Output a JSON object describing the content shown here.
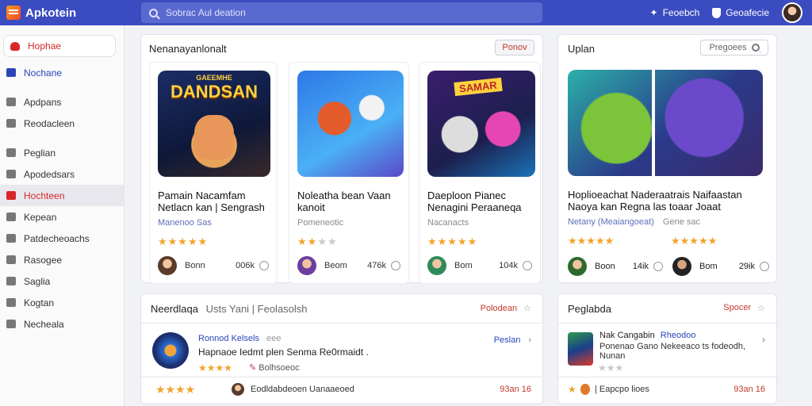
{
  "app": {
    "name": "Apkotein"
  },
  "search": {
    "placeholder": "Sobrac Aul deation"
  },
  "header": {
    "link1": "Feoebch",
    "link2": "Geoafecie"
  },
  "sidebar": {
    "items": [
      {
        "label": "Hophae"
      },
      {
        "label": "Nochane"
      },
      {
        "label": "Apdpans"
      },
      {
        "label": "Reodacleen"
      },
      {
        "label": "Peglian"
      },
      {
        "label": "Apodedsars"
      },
      {
        "label": "Hochteen"
      },
      {
        "label": "Kepean"
      },
      {
        "label": "Patdecheoachs"
      },
      {
        "label": "Rasogee"
      },
      {
        "label": "Saglia"
      },
      {
        "label": "Kogtan"
      },
      {
        "label": "Necheala"
      }
    ]
  },
  "featured": {
    "title": "Nenanayanlonalt",
    "button": "Ponov",
    "cards": [
      {
        "thumb_text": "DANDSAN",
        "thumb_top": "GAEEMHE",
        "title": "Pamain Nacamfam Netlacn kan | Sengrash",
        "sub": "Manenoo Sas",
        "stars": "★★★★★",
        "dim": "",
        "user": "Bonn",
        "count": "006k"
      },
      {
        "thumb_text": "",
        "thumb_top": "",
        "title": "Noleatha bean Vaan kanoit",
        "sub": "Pomeneotic",
        "stars": "★★",
        "dim": "★★",
        "user": "Beom",
        "count": "476k"
      },
      {
        "thumb_text": "",
        "thumb_top": "SAMAR",
        "title": "Daeploon Pianec Nenagini Peraaneqa",
        "sub": "Nacanacts",
        "stars": "★★★★★",
        "dim": "",
        "user": "Bom",
        "count": "104k"
      }
    ]
  },
  "right_panel": {
    "title": "Uplan",
    "search_label": "Pregoees",
    "title_line": "Hoplioeachat Naderaatrais Naifaastan Naoya kan Regna las toaar Joaat",
    "sub_blue": "Netany (Meaiangoeat)",
    "sub_grey": "Gene sac",
    "cards": [
      {
        "user": "Boon",
        "count": "14ik",
        "stars": "★★★★★"
      },
      {
        "user": "Bom",
        "count": "29ik",
        "stars": "★★★★★"
      }
    ]
  },
  "list_panel": {
    "title": "Neerdlaqa",
    "subtitle": "Usts Yani | Feolasolsh",
    "action": "Polodean",
    "row": {
      "name": "Ronnod Kelsels",
      "tag": "eee",
      "desc": "Hapnaoe Iedmt plen Senma Re0rmaidt .",
      "stars": "★★★★",
      "meta": "Bolhsoeoc",
      "link": "Peslan"
    },
    "footer": {
      "stars": "★★★★",
      "text": "Eodldabdeoen Uanaaeoed",
      "price": "93an 16"
    }
  },
  "side_list": {
    "title": "Peglabda",
    "action": "Spocer",
    "row": {
      "name": "Nak Cangabin",
      "name_blue": "Rheodoo",
      "desc": "Ponenao Gano  Nekeeaco ts fodeodh,",
      "desc2": "Nunan",
      "stars": "★★★"
    },
    "footer": {
      "text": "| Eapcpo lioes",
      "price": "93an 16"
    }
  }
}
